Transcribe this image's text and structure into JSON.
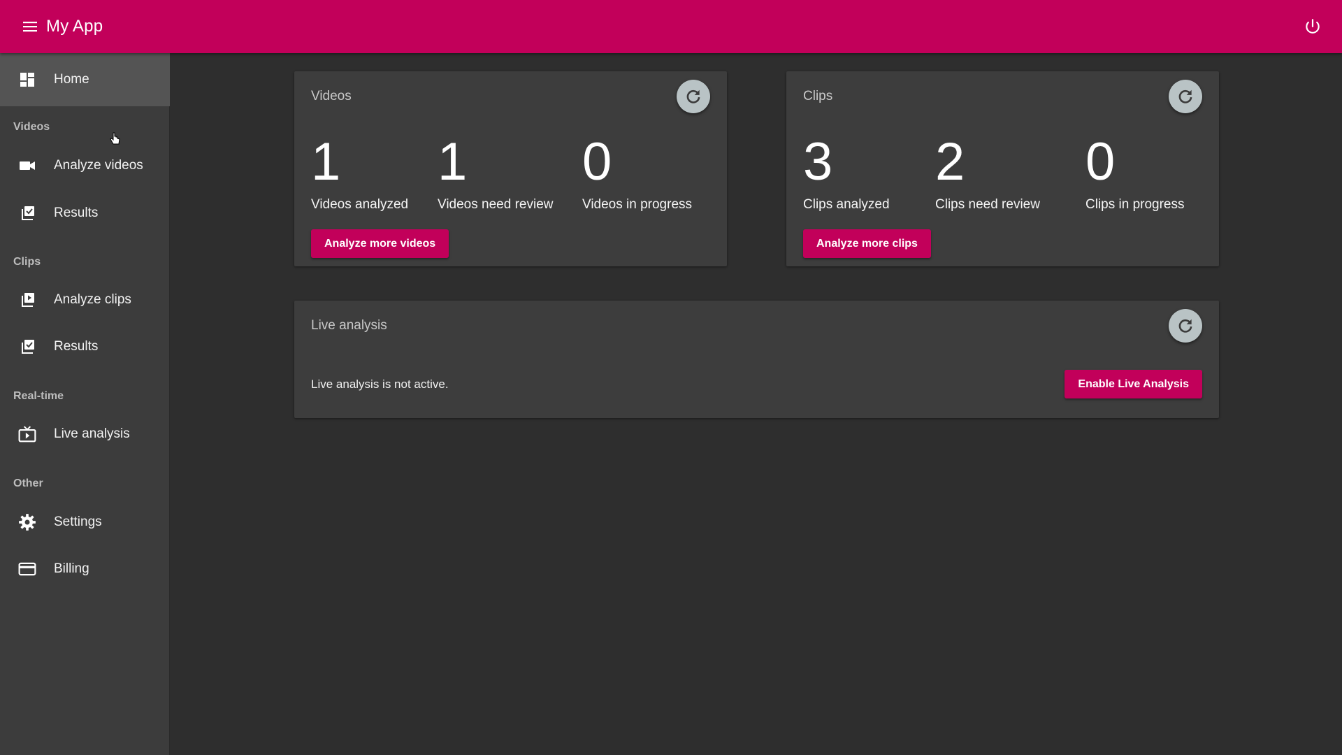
{
  "app": {
    "title": "My App"
  },
  "colors": {
    "brand": "#c2005a",
    "sidebar_bg": "#3c3c3c",
    "sidebar_active": "#545454",
    "card_bg": "#3d3d3d",
    "refresh_bg": "#b9c3c5"
  },
  "sidebar": {
    "home": {
      "label": "Home",
      "icon": "dashboard-icon"
    },
    "sections": {
      "videos": "Videos",
      "clips": "Clips",
      "realtime": "Real-time",
      "other": "Other"
    },
    "analyze_videos": {
      "label": "Analyze videos",
      "icon": "videocam-icon"
    },
    "video_results": {
      "label": "Results",
      "icon": "library-check-icon"
    },
    "analyze_clips": {
      "label": "Analyze clips",
      "icon": "video-library-icon"
    },
    "clip_results": {
      "label": "Results",
      "icon": "library-check-icon"
    },
    "live_analysis": {
      "label": "Live analysis",
      "icon": "live-tv-icon"
    },
    "settings": {
      "label": "Settings",
      "icon": "gear-icon"
    },
    "billing": {
      "label": "Billing",
      "icon": "credit-card-icon"
    }
  },
  "videos_card": {
    "title": "Videos",
    "stats": [
      {
        "value": "1",
        "label": "Videos analyzed"
      },
      {
        "value": "1",
        "label": "Videos need review"
      },
      {
        "value": "0",
        "label": "Videos in progress"
      }
    ],
    "button": "Analyze more videos"
  },
  "clips_card": {
    "title": "Clips",
    "stats": [
      {
        "value": "3",
        "label": "Clips analyzed"
      },
      {
        "value": "2",
        "label": "Clips need review"
      },
      {
        "value": "0",
        "label": "Clips in progress"
      }
    ],
    "button": "Analyze more clips"
  },
  "live_card": {
    "title": "Live analysis",
    "status": "Live analysis is not active.",
    "button": "Enable Live Analysis"
  }
}
